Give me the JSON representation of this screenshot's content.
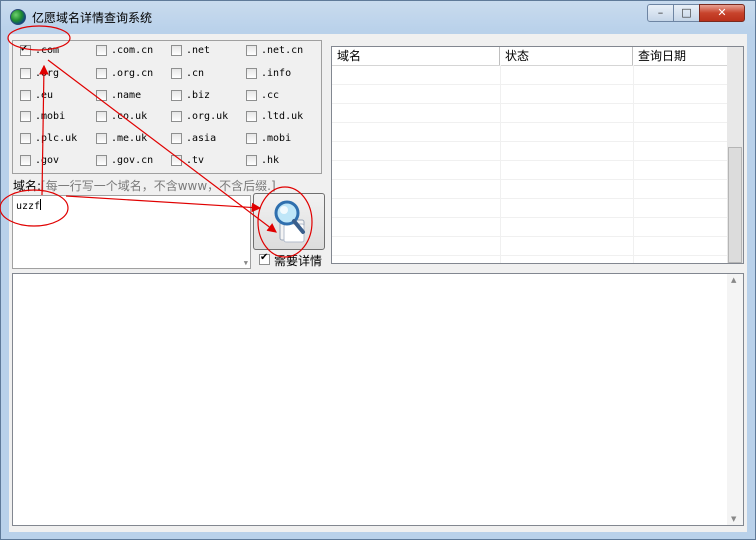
{
  "window": {
    "title": "亿愿域名详情查询系统",
    "minimize": "–",
    "maximize": "□",
    "close": "✕"
  },
  "tlds": [
    {
      "label": ".com",
      "checked": true
    },
    {
      "label": ".com.cn",
      "checked": false
    },
    {
      "label": ".net",
      "checked": false
    },
    {
      "label": ".net.cn",
      "checked": false
    },
    {
      "label": ".org",
      "checked": false
    },
    {
      "label": ".org.cn",
      "checked": false
    },
    {
      "label": ".cn",
      "checked": false
    },
    {
      "label": ".info",
      "checked": false
    },
    {
      "label": ".eu",
      "checked": false
    },
    {
      "label": ".name",
      "checked": false
    },
    {
      "label": ".biz",
      "checked": false
    },
    {
      "label": ".cc",
      "checked": false
    },
    {
      "label": ".mobi",
      "checked": false
    },
    {
      "label": ".co.uk",
      "checked": false
    },
    {
      "label": ".org.uk",
      "checked": false
    },
    {
      "label": ".ltd.uk",
      "checked": false
    },
    {
      "label": ".plc.uk",
      "checked": false
    },
    {
      "label": ".me.uk",
      "checked": false
    },
    {
      "label": ".asia",
      "checked": false
    },
    {
      "label": ".mobi",
      "checked": false
    },
    {
      "label": ".gov",
      "checked": false
    },
    {
      "label": ".gov.cn",
      "checked": false
    },
    {
      "label": ".tv",
      "checked": false
    },
    {
      "label": ".hk",
      "checked": false
    }
  ],
  "domain_input": {
    "label": "域名:",
    "hint": "[每一行写一个域名，不含www，不含后缀.]",
    "value": "uzzf"
  },
  "search_button": {
    "icon": "magnifier-icon"
  },
  "need_detail": {
    "label": "需要详情",
    "checked": true
  },
  "result_list": {
    "columns": [
      "域名",
      "状态",
      "查询日期"
    ]
  },
  "colors": {
    "annotation": "#e00000",
    "titlebar": "#b9d1ea",
    "close_button": "#c8432c"
  }
}
